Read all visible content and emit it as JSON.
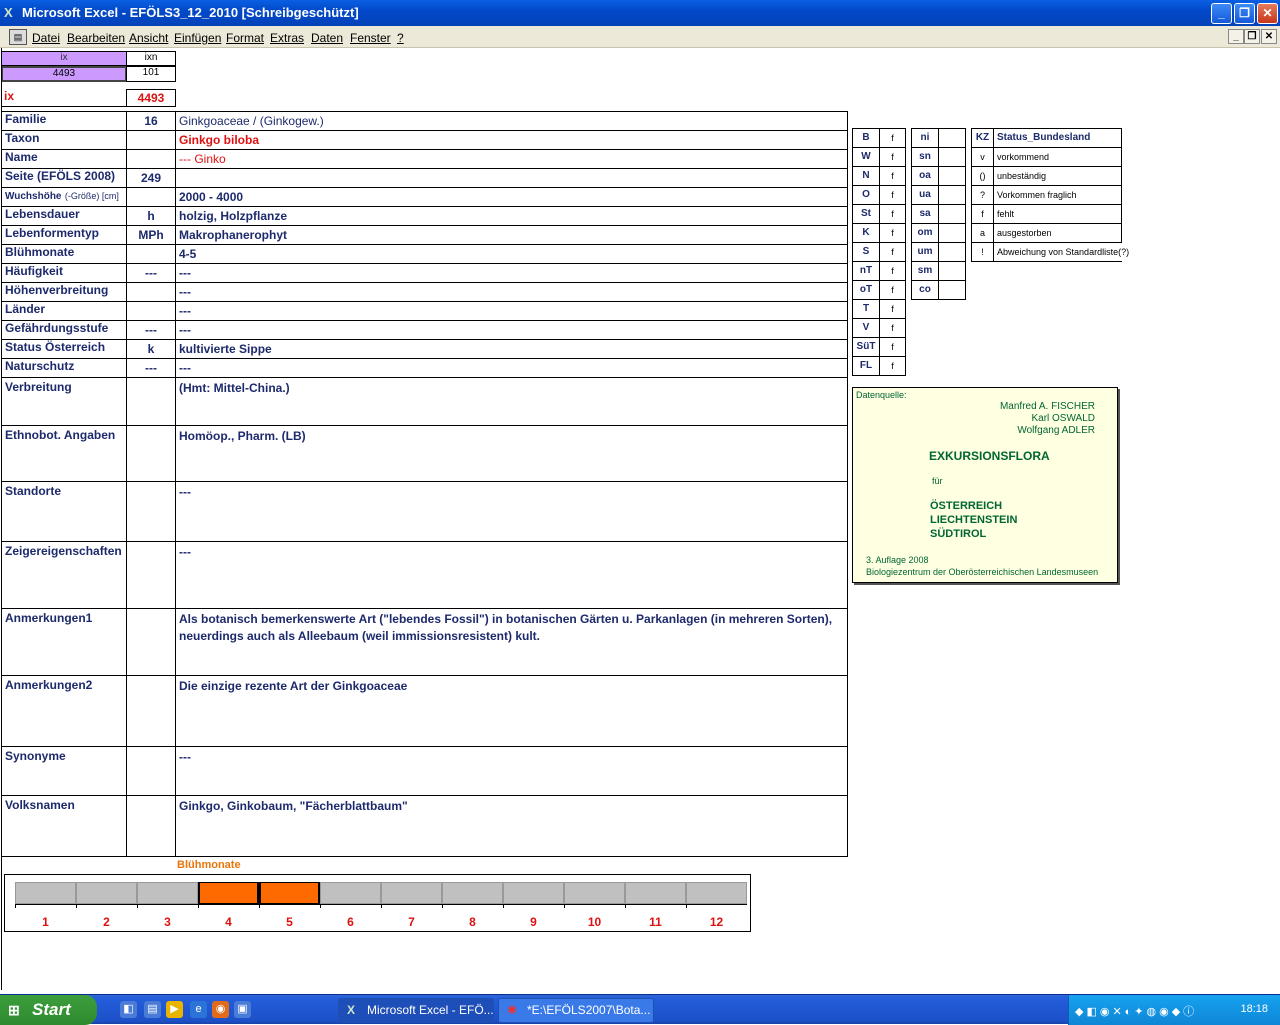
{
  "window": {
    "title": "Microsoft Excel - EFÖLS3_12_2010  [Schreibgeschützt]",
    "app_icon": "excel-icon"
  },
  "menu": [
    "Datei",
    "Bearbeiten",
    "Ansicht",
    "Einfügen",
    "Format",
    "Extras",
    "Daten",
    "Fenster",
    "?"
  ],
  "ix_header": {
    "ix": "ix",
    "ixn": "ixn",
    "ix_val": "4493",
    "ixn_val": "101"
  },
  "ix_row": {
    "label": "ix",
    "value": "4493"
  },
  "rows": [
    {
      "label": "Familie",
      "mid": "16",
      "value": "Ginkgoaceae  /  (Ginkogew.)"
    },
    {
      "label": "Taxon",
      "mid": "",
      "value": "Ginkgo biloba"
    },
    {
      "label": "Name",
      "mid": "",
      "value": "--- Ginko"
    },
    {
      "label": "Seite (EFÖLS 2008)",
      "mid": "249",
      "value": ""
    },
    {
      "label": "Wuchshöhe",
      "label_suffix": "(-Größe) [cm]",
      "mid": "",
      "value": "2000 - 4000"
    },
    {
      "label": "Lebensdauer",
      "mid": "h",
      "value": "holzig, Holzpflanze"
    },
    {
      "label": "Lebenformentyp",
      "mid": "MPh",
      "value": "Makrophanerophyt"
    },
    {
      "label": "Blühmonate",
      "mid": "",
      "value": "4-5"
    },
    {
      "label": "Häufigkeit",
      "mid": "---",
      "value": "---"
    },
    {
      "label": "Höhenverbreitung",
      "mid": "",
      "value": "---"
    },
    {
      "label": "Länder",
      "mid": "",
      "value": "---"
    },
    {
      "label": "Gefährdungsstufe",
      "mid": "---",
      "value": "---"
    },
    {
      "label": "Status Österreich",
      "mid": "k",
      "value": "kultivierte Sippe"
    },
    {
      "label": "Naturschutz",
      "mid": "---",
      "value": "---"
    }
  ],
  "tall_rows": [
    {
      "label": "Verbreitung",
      "value": "(Hmt: Mittel-China.)"
    },
    {
      "label": "Ethnobot. Angaben",
      "value": "Homöop., Pharm. (LB)"
    },
    {
      "label": "Standorte",
      "value": "---"
    },
    {
      "label": "Zeigereigenschaften",
      "value": "---"
    },
    {
      "label": "Anmerkungen1",
      "value": "Als botanisch bemerkenswerte Art (\"lebendes Fossil\") in botanischen Gärten u. Parkanlagen (in mehreren Sorten), neuerdings auch als Alleebaum (weil immissionsresistent) kult."
    },
    {
      "label": "Anmerkungen2",
      "value": "Die einzige rezente Art der Ginkgoaceae"
    },
    {
      "label": "Synonyme",
      "value": "---"
    },
    {
      "label": "Volksnamen",
      "value": "Ginkgo, Ginkobaum, \"Fächerblattbaum\""
    }
  ],
  "regions1": [
    "B",
    "W",
    "N",
    "O",
    "St",
    "K",
    "S",
    "nT",
    "oT",
    "T",
    "V",
    "SüT",
    "FL"
  ],
  "regions_flag": "f",
  "regions2": [
    "ni",
    "sn",
    "oa",
    "ua",
    "sa",
    "om",
    "um",
    "sm",
    "co"
  ],
  "status_legend": {
    "kz_header": "KZ",
    "title": "Status_Bundesland",
    "items": [
      {
        "kz": "v",
        "text": "vorkommend"
      },
      {
        "kz": "()",
        "text": "unbeständig"
      },
      {
        "kz": "?",
        "text": "Vorkommen fraglich"
      },
      {
        "kz": "f",
        "text": "fehlt"
      },
      {
        "kz": "a",
        "text": "ausgestorben"
      },
      {
        "kz": "!",
        "text": "Abweichung von Standardliste(?)"
      }
    ]
  },
  "source": {
    "label": "Datenquelle:",
    "authors": [
      "Manfred A. FISCHER",
      "Karl OSWALD",
      "Wolfgang ADLER"
    ],
    "title": "EXKURSIONSFLORA",
    "fuer": "für",
    "regions": [
      "ÖSTERREICH",
      "LIECHTENSTEIN",
      "SÜDTIROL"
    ],
    "edition": "3. Auflage 2008",
    "publisher": "Biologiezentrum der Oberösterreichischen Landesmuseen"
  },
  "bloom": {
    "title": "Blühmonate",
    "months": [
      "1",
      "2",
      "3",
      "4",
      "5",
      "6",
      "7",
      "8",
      "9",
      "10",
      "11",
      "12"
    ],
    "active": [
      4,
      5
    ],
    "active_color": "#ff6a00",
    "inactive_color": "#c0c0c0"
  },
  "taskbar": {
    "start": "Start",
    "buttons": [
      "Microsoft Excel - EFÖ...",
      "*E:\\EFÖLS2007\\Bota..."
    ],
    "clock": "18:18"
  }
}
